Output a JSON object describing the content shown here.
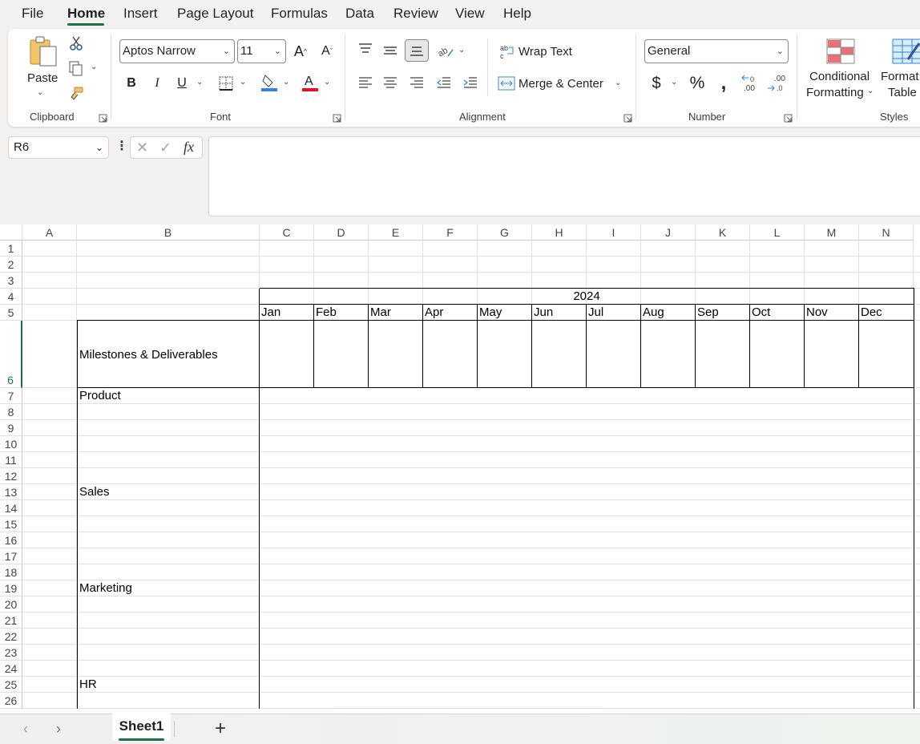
{
  "menu": {
    "tabs": [
      "File",
      "Home",
      "Insert",
      "Page Layout",
      "Formulas",
      "Data",
      "Review",
      "View",
      "Help"
    ],
    "active": "Home"
  },
  "ribbon": {
    "clipboard": {
      "paste_label": "Paste",
      "group_label": "Clipboard"
    },
    "font": {
      "font_name": "Aptos Narrow",
      "font_size": "11",
      "group_label": "Font"
    },
    "alignment": {
      "wrap_text": "Wrap Text",
      "merge_center": "Merge & Center",
      "group_label": "Alignment"
    },
    "number": {
      "format": "General",
      "group_label": "Number"
    },
    "styles": {
      "conditional_line1": "Conditional",
      "conditional_line2": "Formatting",
      "format_line1": "Format",
      "format_line2": "Table",
      "group_label": "Styles"
    }
  },
  "formula_bar": {
    "name_box": "R6",
    "formula": ""
  },
  "sheet": {
    "columns": [
      "A",
      "B",
      "C",
      "D",
      "E",
      "F",
      "G",
      "H",
      "I",
      "J",
      "K",
      "L",
      "M",
      "N"
    ],
    "rows": [
      "1",
      "2",
      "3",
      "4",
      "5",
      "6",
      "7",
      "8",
      "9",
      "10",
      "11",
      "12",
      "13",
      "14",
      "15",
      "16",
      "17",
      "18",
      "19",
      "20",
      "21",
      "22",
      "23",
      "24",
      "25",
      "26"
    ],
    "year": "2024",
    "months": [
      "Jan",
      "Feb",
      "Mar",
      "Apr",
      "May",
      "Jun",
      "Jul",
      "Aug",
      "Sep",
      "Oct",
      "Nov",
      "Dec"
    ],
    "milestones_header": "Milestones & Deliverables",
    "sections": [
      {
        "label": "Product",
        "row": 7
      },
      {
        "label": "Sales",
        "row": 13
      },
      {
        "label": "Marketing",
        "row": 19
      },
      {
        "label": "HR",
        "row": 25
      }
    ],
    "selected_row": "6"
  },
  "sheet_tabs": {
    "tabs": [
      "Sheet1"
    ],
    "active": "Sheet1"
  },
  "colors": {
    "accent": "#1e7145",
    "font_color": "#e81123",
    "fill_color": "#2b88d8"
  }
}
